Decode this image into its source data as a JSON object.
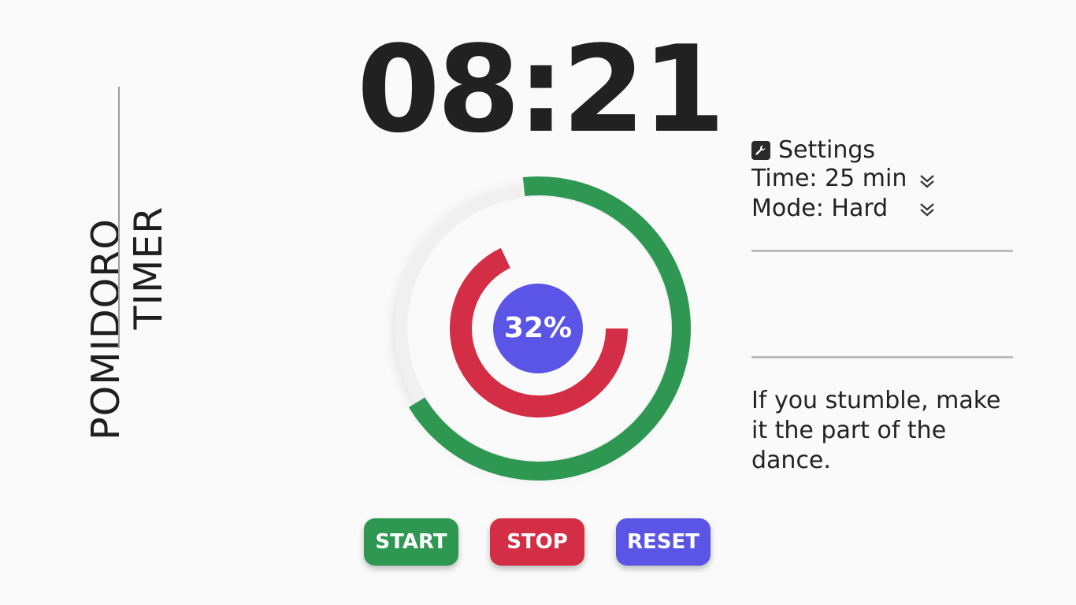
{
  "app": {
    "title_line1": "POMIDORO",
    "title_line2": "TIMER"
  },
  "timer": {
    "display": "08:21",
    "progress_percent_label": "32%",
    "outer_ring_progress": 0.68,
    "inner_ring_progress": 0.68
  },
  "controls": {
    "start_label": "START",
    "stop_label": "STOP",
    "reset_label": "RESET"
  },
  "settings": {
    "title": "Settings",
    "icon": "wrench-icon",
    "time_label": "Time: 25 min",
    "mode_label": "Mode: Hard"
  },
  "quote": {
    "text": "If you stumble, make it the part of the dance."
  },
  "colors": {
    "green": "#2e9752",
    "red": "#d42d46",
    "indigo": "#5b55e6",
    "track": "#f0f0f0"
  }
}
